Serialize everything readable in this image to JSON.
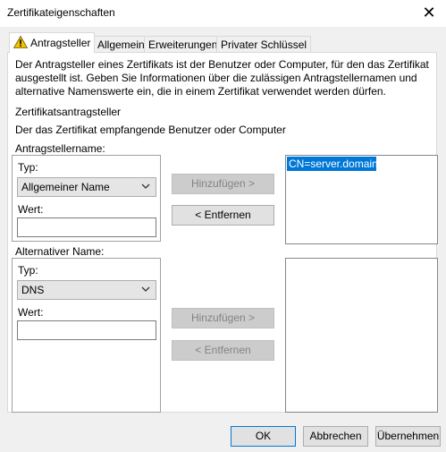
{
  "window": {
    "title": "Zertifikateigenschaften",
    "close_glyph": "✕"
  },
  "tabs": [
    {
      "label": "Antragsteller",
      "icon": "warning-icon"
    },
    {
      "label": "Allgemein"
    },
    {
      "label": "Erweiterungen"
    },
    {
      "label": "Privater Schlüssel"
    }
  ],
  "intro": {
    "line1": "Der Antragsteller eines Zertifikats ist der Benutzer oder Computer, für den das Zertifikat",
    "line2": "ausgestellt ist. Geben Sie Informationen über die zulässigen Antragstellernamen und",
    "line3": "alternative Namenswerte ein, die in einem Zertifikat verwendet werden dürfen."
  },
  "section": {
    "heading": "Zertifikatsantragsteller",
    "subheading": "Der das Zertifikat empfangende Benutzer oder Computer"
  },
  "subject_name": {
    "label": "Antragstellername:",
    "type_label": "Typ:",
    "type_value": "Allgemeiner Name",
    "value_label": "Wert:",
    "value": "",
    "add_button": "Hinzufügen >",
    "remove_button": "< Entfernen",
    "list_items": [
      "CN=server.domain"
    ]
  },
  "alt_name": {
    "label": "Alternativer Name:",
    "type_label": "Typ:",
    "type_value": "DNS",
    "value_label": "Wert:",
    "value": "",
    "add_button": "Hinzufügen >",
    "remove_button": "< Entfernen",
    "list_items": []
  },
  "footer": {
    "ok": "OK",
    "cancel": "Abbrechen",
    "apply": "Übernehmen"
  },
  "colors": {
    "selection": "#0078d7",
    "warning": "#f2c200"
  }
}
